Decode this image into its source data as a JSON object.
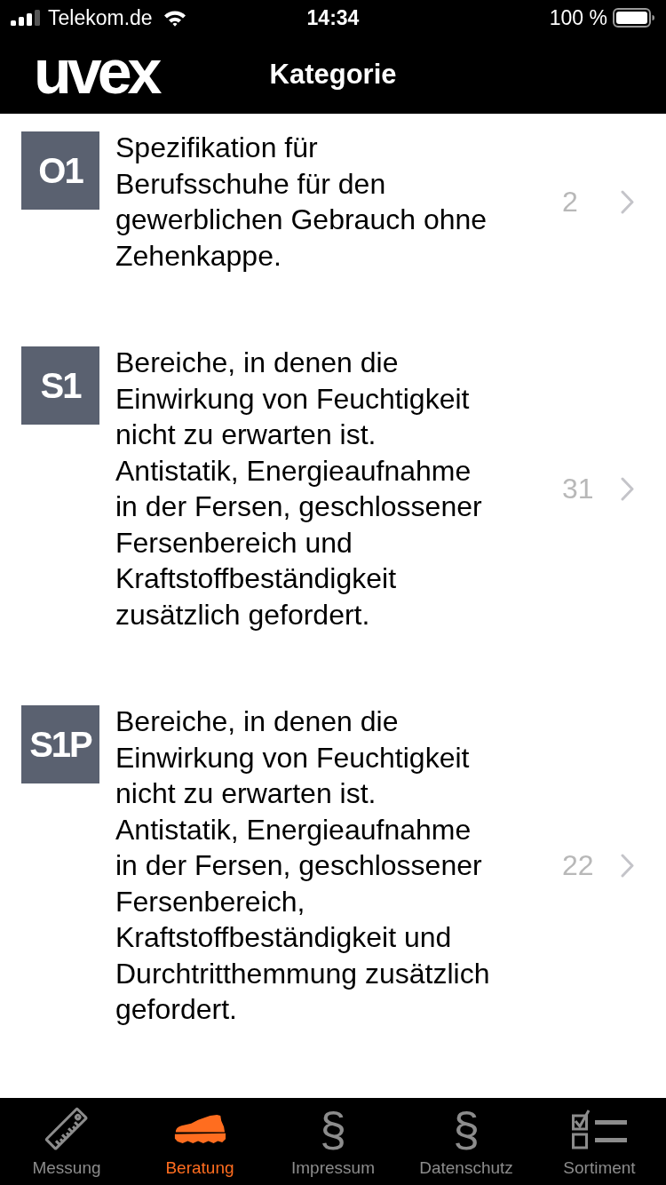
{
  "status_bar": {
    "carrier": "Telekom.de",
    "time": "14:34",
    "battery": "100 %"
  },
  "nav_bar": {
    "logo": "uvex",
    "title": "Kategorie"
  },
  "categories": [
    {
      "code": "O1",
      "description": "Spezifikation für\nBerufsschuhe für den\ngewerblichen Gebrauch ohne\nZehenkappe.",
      "count": "2"
    },
    {
      "code": "S1",
      "description": "Bereiche, in denen die\nEinwirkung von Feuchtigkeit\nnicht zu erwarten ist.\nAntistatik, Energieaufnahme\nin der Fersen, geschlossener\nFersenbereich und\nKraftstoffbeständigkeit\nzusätzlich gefordert.",
      "count": "31"
    },
    {
      "code": "S1P",
      "description": "Bereiche, in denen die\nEinwirkung von Feuchtigkeit\nnicht zu erwarten ist.\nAntistatik, Energieaufnahme\nin der Fersen, geschlossener\nFersenbereich,\nKraftstoffbeständigkeit und\nDurchtritthemmung zusätzlich\ngefordert.",
      "count": "22"
    }
  ],
  "tab_bar": [
    {
      "label": "Messung",
      "selected": false,
      "kind": "ruler"
    },
    {
      "label": "Beratung",
      "selected": true,
      "kind": "shoe"
    },
    {
      "label": "Impressum",
      "selected": false,
      "kind": "glyph",
      "glyph": "§"
    },
    {
      "label": "Datenschutz",
      "selected": false,
      "kind": "glyph",
      "glyph": "§"
    },
    {
      "label": "Sortiment",
      "selected": false,
      "kind": "checklist"
    }
  ]
}
